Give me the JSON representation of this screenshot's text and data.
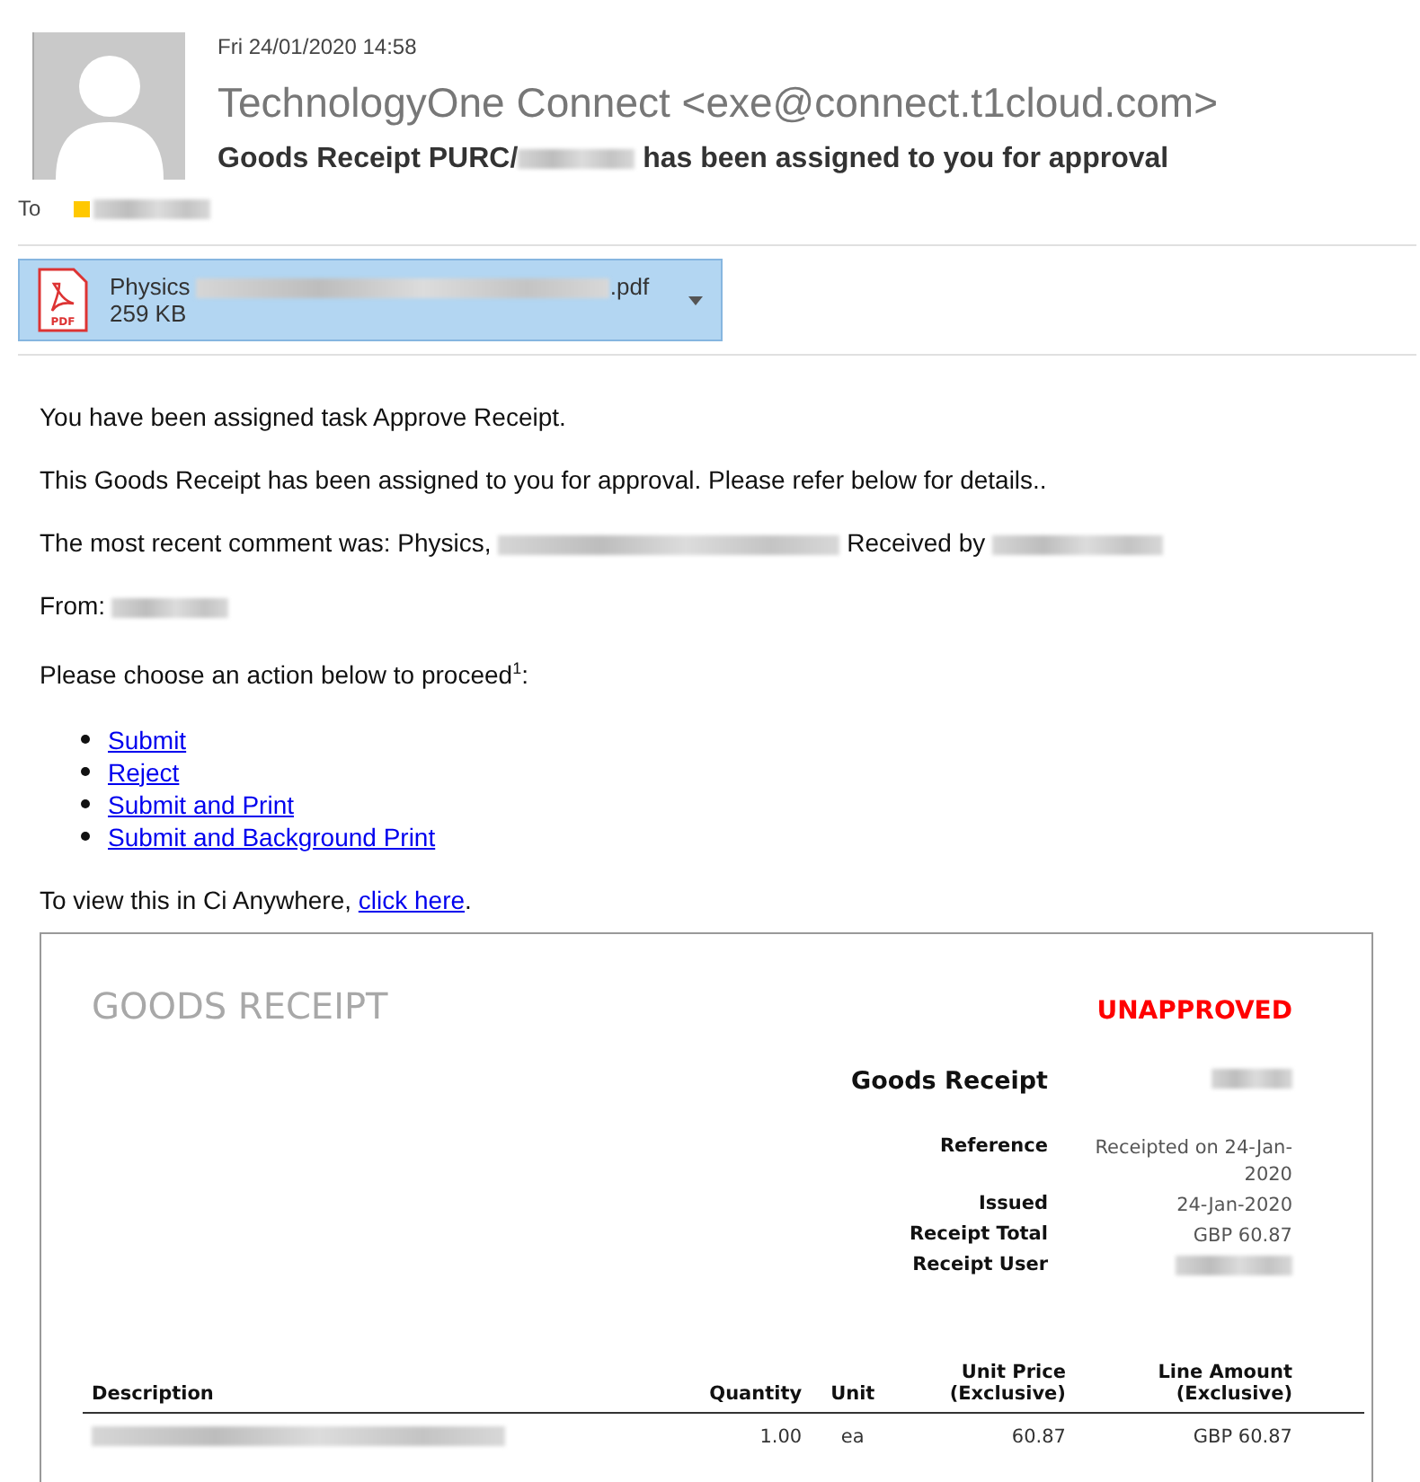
{
  "message": {
    "date": "Fri 24/01/2020 14:58",
    "sender": "TechnologyOne Connect <exe@connect.t1cloud.com>",
    "subject": [
      {
        "kind": "text",
        "text": "Goods Receipt PURC/"
      },
      {
        "kind": "redacted_short"
      },
      {
        "kind": "text",
        "text": " has been assigned to you for approval"
      }
    ],
    "to_label": "To",
    "recipient": {
      "color": "#ffc800",
      "name": [
        {
          "kind": "redacted_short"
        }
      ]
    }
  },
  "attachment": {
    "selected": true,
    "file_type": "PDF",
    "name": [
      {
        "kind": "text",
        "text": "Physics "
      },
      {
        "kind": "redacted_xlong"
      },
      {
        "kind": "text",
        "text": ".pdf"
      }
    ],
    "size": "259 KB"
  },
  "body": [
    {
      "kind": "paragraph",
      "segments": [
        {
          "kind": "text",
          "text": "You have been assigned task Approve Receipt."
        }
      ]
    },
    {
      "kind": "paragraph",
      "segments": [
        {
          "kind": "text",
          "text": "This Goods Receipt has been assigned to you for approval. Please refer below for details.."
        }
      ]
    },
    {
      "kind": "paragraph",
      "segments": [
        {
          "kind": "text",
          "text": "The most recent comment was: Physics, "
        },
        {
          "kind": "redacted_long"
        },
        {
          "kind": "text",
          "text": " Received by "
        },
        {
          "kind": "redacted_medium"
        }
      ]
    },
    {
      "kind": "paragraph",
      "segments": [
        {
          "kind": "text",
          "text": "From: "
        },
        {
          "kind": "redacted_short"
        }
      ]
    },
    {
      "kind": "paragraph",
      "segments": [
        {
          "kind": "text",
          "text": "Please choose an action below to proceed$^{1}$:"
        }
      ]
    },
    {
      "kind": "links",
      "items": [
        "Submit",
        "Reject",
        "Submit and Print",
        "Submit and Background Print"
      ]
    },
    {
      "kind": "paragraph",
      "segments": [
        {
          "kind": "text",
          "text": "To view this in Ci Anywhere, "
        },
        {
          "kind": "link",
          "text": "click here"
        },
        {
          "kind": "text",
          "text": "."
        }
      ]
    }
  ],
  "report": {
    "title": "GOODS RECEIPT",
    "status": {
      "text": "UNAPPROVED",
      "approved": false
    },
    "details": [
      {
        "kind": "heading",
        "label": "Goods Receipt",
        "value": [
          {
            "kind": "redacted_tiny"
          }
        ]
      },
      {
        "kind": "field",
        "label": "Reference",
        "value": [
          {
            "kind": "text",
            "text": "Receipted on 24-Jan-2020"
          }
        ]
      },
      {
        "kind": "field",
        "label": "Issued",
        "value": [
          {
            "kind": "text",
            "text": "24-Jan-2020"
          }
        ]
      },
      {
        "kind": "field",
        "label": "Receipt Total",
        "value": [
          {
            "kind": "text",
            "text": "GBP 60.87"
          }
        ]
      },
      {
        "kind": "field",
        "label": "Receipt User",
        "value": [
          {
            "kind": "redacted_short"
          }
        ]
      }
    ],
    "table": {
      "columns": [
        "Description",
        "Quantity",
        "Unit",
        "Unit Price\n(Exclusive)",
        "Line Amount\n(Exclusive)"
      ],
      "rows": [
        {
          "cells": [
            [
              {
                "kind": "redacted_xlong"
              }
            ],
            [
              {
                "kind": "text",
                "text": "1.00"
              }
            ],
            [
              {
                "kind": "text",
                "text": "ea"
              }
            ],
            [
              {
                "kind": "text",
                "text": "60.87"
              }
            ],
            [
              {
                "kind": "text",
                "text": "GBP 60.87"
              }
            ]
          ]
        }
      ]
    }
  }
}
